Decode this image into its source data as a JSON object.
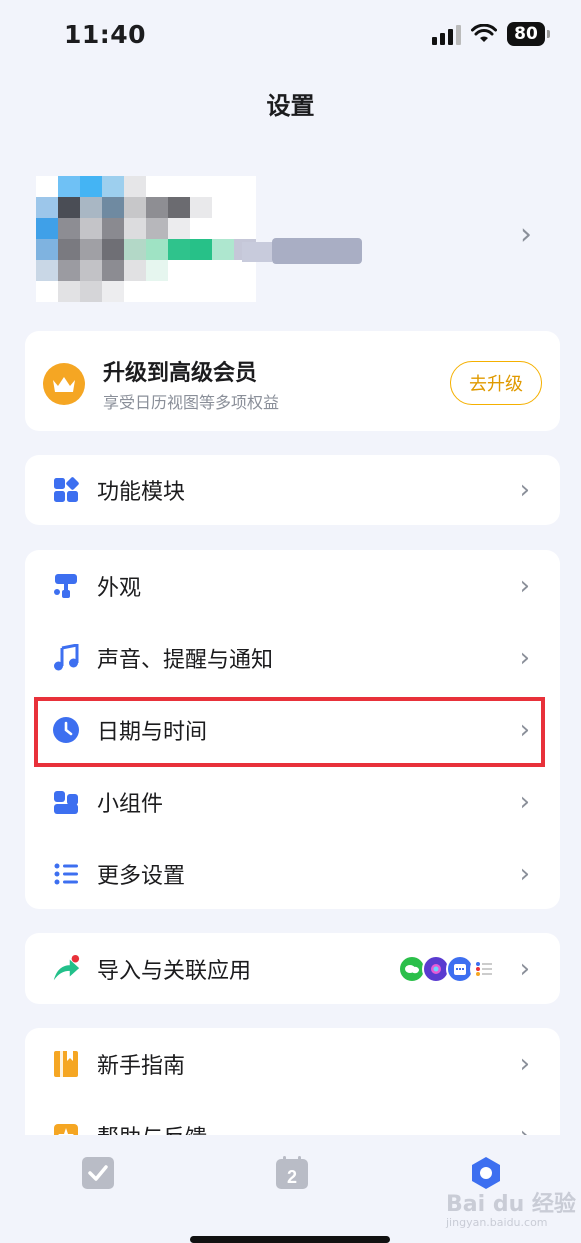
{
  "status": {
    "time": "11:40",
    "battery": "80"
  },
  "header": {
    "title": "设置"
  },
  "vip": {
    "title": "升级到高级会员",
    "subtitle": "享受日历视图等多项权益",
    "button": "去升级"
  },
  "sections": {
    "modules": {
      "label": "功能模块"
    },
    "appearance": {
      "label": "外观"
    },
    "sound": {
      "label": "声音、提醒与通知"
    },
    "datetime": {
      "label": "日期与时间"
    },
    "widgets": {
      "label": "小组件"
    },
    "more": {
      "label": "更多设置"
    },
    "import": {
      "label": "导入与关联应用"
    },
    "guide": {
      "label": "新手指南"
    },
    "help": {
      "label": "帮助与反馈"
    }
  },
  "tabbar": {
    "calendar_day": "2"
  },
  "watermark": {
    "brand": "Bai du 经验",
    "url": "jingyan.baidu.com"
  },
  "colors": {
    "accent": "#3d6ff0",
    "highlight": "#e8313a",
    "vip": "#f5a623",
    "background": "#f2f4fb"
  }
}
